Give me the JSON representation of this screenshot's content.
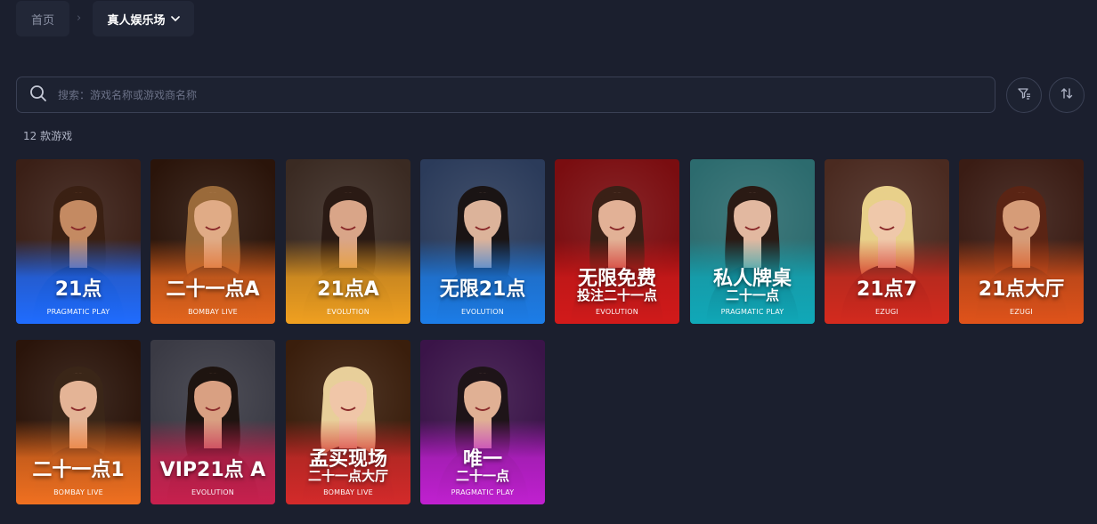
{
  "breadcrumb": {
    "home": "首页",
    "separator": "›",
    "current": "真人娱乐场",
    "dropdown_icon": "chevron-down-icon"
  },
  "search": {
    "placeholder": "搜索：游戏名称或游戏商名称",
    "value": "",
    "icon": "search-icon"
  },
  "toolbar": {
    "filter_icon": "filter-icon",
    "sort_icon": "sort-icon"
  },
  "game_count": "12 款游戏",
  "games": [
    {
      "line1": "21点",
      "line2": "",
      "provider": "PRAGMATIC PLAY",
      "accent": "#1f6cff",
      "bg": "#3a1f16",
      "skin": "#c48a62",
      "hair": "#3a2013"
    },
    {
      "line1": "二十一点A",
      "line2": "",
      "provider": "BOMBAY LIVE",
      "accent": "#e4651d",
      "bg": "#2a140a",
      "skin": "#e0ab86",
      "hair": "#9a6a3a"
    },
    {
      "line1": "21点A",
      "line2": "",
      "provider": "EVOLUTION",
      "accent": "#f0a020",
      "bg": "#3a2a22",
      "skin": "#d9a588",
      "hair": "#2a1a14"
    },
    {
      "line1": "无限21点",
      "line2": "",
      "provider": "EVOLUTION",
      "accent": "#1c7de8",
      "bg": "#2b3b5a",
      "skin": "#dcb39a",
      "hair": "#1a1414"
    },
    {
      "line1": "无限免费",
      "line2": "投注二十一点",
      "provider": "EVOLUTION",
      "accent": "#d21a1a",
      "bg": "#7a0d10",
      "skin": "#e2b196",
      "hair": "#3a2016"
    },
    {
      "line1": "私人牌桌",
      "line2": "二十一点",
      "provider": "PRAGMATIC PLAY",
      "accent": "#10a8b8",
      "bg": "#2c6b6e",
      "skin": "#e2b8a0",
      "hair": "#2a1a14"
    },
    {
      "line1": "21点7",
      "line2": "",
      "provider": "EZUGI",
      "accent": "#d42a1e",
      "bg": "#4a2a20",
      "skin": "#efc8aa",
      "hair": "#e8d08a"
    },
    {
      "line1": "21点大厅",
      "line2": "",
      "provider": "EZUGI",
      "accent": "#e0531a",
      "bg": "#3a1c14",
      "skin": "#d69c78",
      "hair": "#5a2414"
    },
    {
      "line1": "二十一点1",
      "line2": "",
      "provider": "BOMBAY LIVE",
      "accent": "#f07020",
      "bg": "#2a140a",
      "skin": "#e4b496",
      "hair": "#3a2618"
    },
    {
      "line1": "VIP21点 A",
      "line2": "",
      "provider": "EVOLUTION",
      "accent": "#c8204e",
      "bg": "#3a3a44",
      "skin": "#d9a082",
      "hair": "#1e1410"
    },
    {
      "line1": "孟买现场",
      "line2": "二十一点大厅",
      "provider": "BOMBAY LIVE",
      "accent": "#d42a2a",
      "bg": "#3a1e0c",
      "skin": "#f0c6a8",
      "hair": "#e8cf9a"
    },
    {
      "line1": "唯一",
      "line2": "二十一点",
      "provider": "PRAGMATIC PLAY",
      "accent": "#c020d0",
      "bg": "#3a1448",
      "skin": "#e0b094",
      "hair": "#1e1418"
    }
  ]
}
